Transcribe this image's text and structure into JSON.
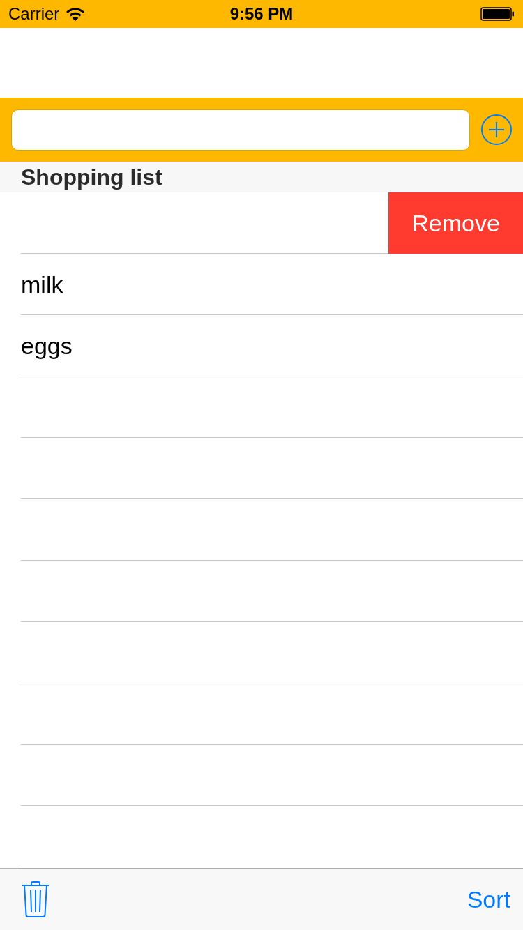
{
  "status_bar": {
    "carrier": "Carrier",
    "time": "9:56 PM"
  },
  "section": {
    "title": "Shopping list"
  },
  "rows": [
    {
      "swiped": true,
      "remove_button": "Remove"
    },
    {
      "label": "milk",
      "swiped": false
    },
    {
      "label": "eggs",
      "swiped": false
    }
  ],
  "toolbar": {
    "sort_button": "Sort"
  }
}
